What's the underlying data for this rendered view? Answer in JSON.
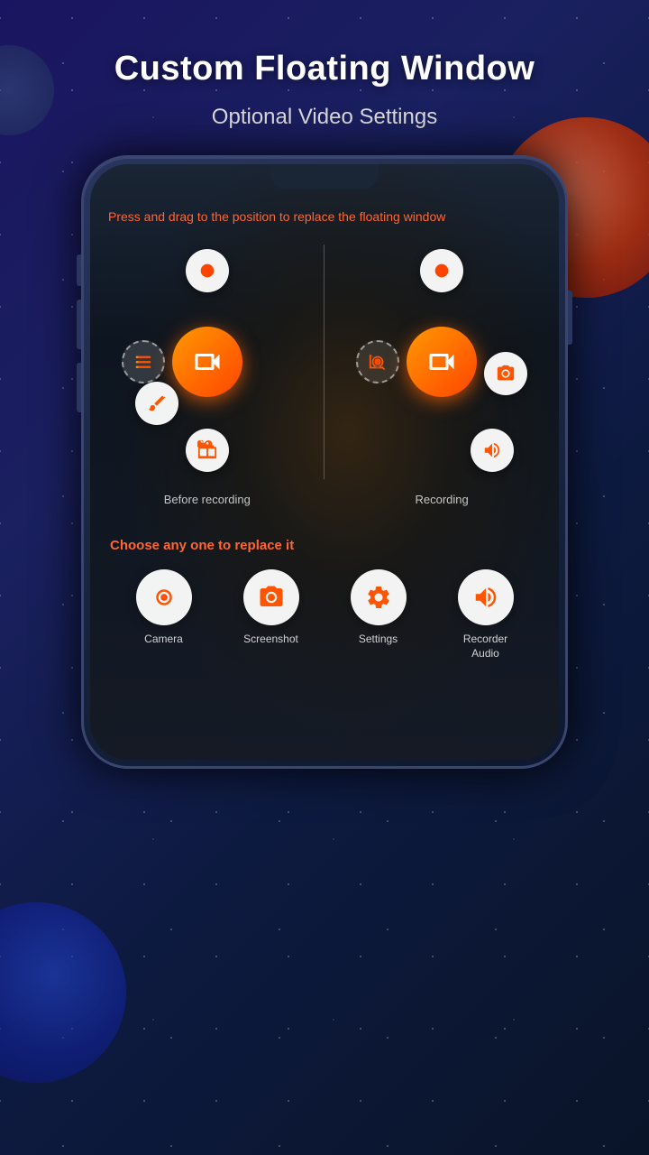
{
  "page": {
    "title": "Custom Floating Window",
    "subtitle": "Optional Video Settings",
    "instruction": "Press and drag to the position to replace the floating window",
    "choose_label": "Choose any one to replace it",
    "before_recording_label": "Before recording",
    "recording_label": "Recording",
    "bottom_icons": [
      {
        "id": "camera",
        "label": "Camera",
        "icon": "camera"
      },
      {
        "id": "screenshot",
        "label": "Screenshot",
        "icon": "screenshot"
      },
      {
        "id": "settings",
        "label": "Settings",
        "icon": "settings"
      },
      {
        "id": "recorder-audio",
        "label": "Recorder Audio",
        "icon": "audio"
      }
    ]
  },
  "colors": {
    "orange": "#ff5500",
    "orange_light": "#ff8800",
    "text_orange": "#ff6633",
    "white": "#ffffff",
    "bg_dark": "#0d1428"
  }
}
